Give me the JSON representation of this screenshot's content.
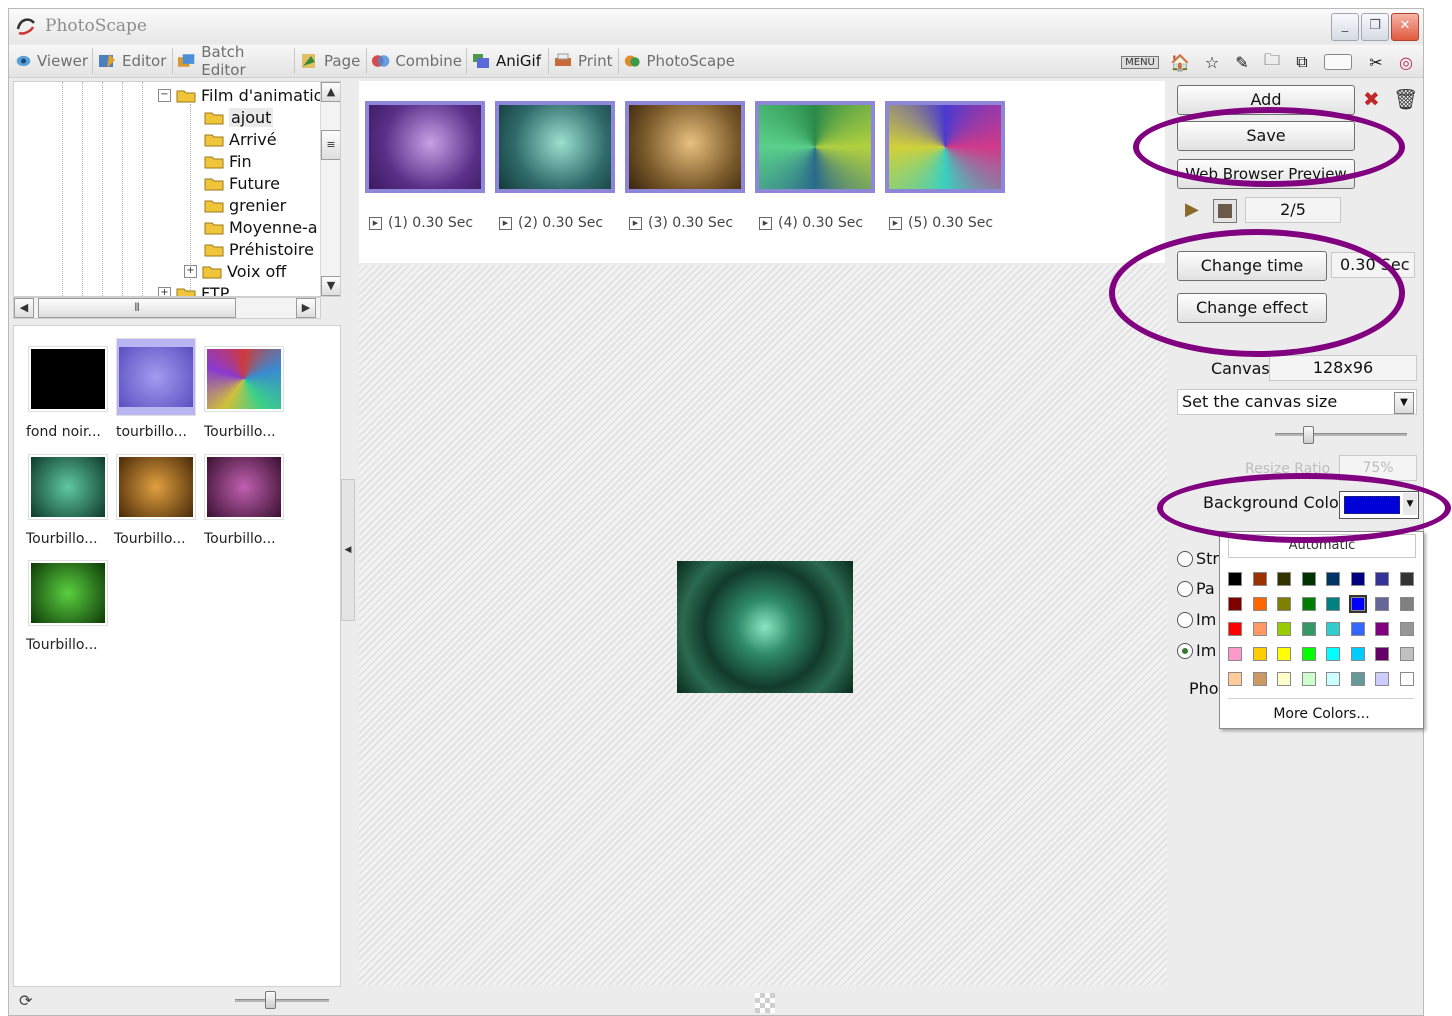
{
  "window": {
    "title": "PhotoScape",
    "minimize": "_",
    "restore": "❐",
    "close": "✕"
  },
  "colors": {
    "highlight_oval": "#800080",
    "selected_color": "#0000d8",
    "accent": "#8e86d8"
  },
  "tabs": [
    {
      "label": "Viewer",
      "icon": "viewer-icon"
    },
    {
      "label": "Editor",
      "icon": "editor-icon"
    },
    {
      "label": "Batch Editor",
      "icon": "batch-editor-icon"
    },
    {
      "label": "Page",
      "icon": "page-icon"
    },
    {
      "label": "Combine",
      "icon": "combine-icon"
    },
    {
      "label": "AniGif",
      "icon": "anigif-icon",
      "active": true
    },
    {
      "label": "Print",
      "icon": "print-icon"
    },
    {
      "label": "PhotoScape",
      "icon": "photoscape-icon"
    }
  ],
  "toolbar": {
    "menu_label": "MENU",
    "icons": [
      "home-icon",
      "star-icon",
      "tools-icon",
      "folder-open-icon",
      "copy-icon",
      "blank-icon",
      "scissors-icon",
      "help-icon"
    ]
  },
  "tree": {
    "root": "Film d'animatio",
    "items": [
      "ajout",
      "Arrivé",
      "Fin",
      "Future",
      "grenier",
      "Moyenne-a",
      "Préhistoire",
      "Voix off",
      "FTP"
    ],
    "selected": "ajout"
  },
  "thumbnails": [
    {
      "caption": "fond noir...",
      "swatch": "#000000"
    },
    {
      "caption": "tourbillo...",
      "swatch": "#7a6fcf",
      "selected": true
    },
    {
      "caption": "Tourbillo...",
      "swatch": "#3d2a44"
    },
    {
      "caption": "Tourbillo...",
      "swatch": "#1f5a4a"
    },
    {
      "caption": "Tourbillo...",
      "swatch": "#7a4f12"
    },
    {
      "caption": "Tourbillo...",
      "swatch": "#5a2a4e"
    },
    {
      "caption": "Tourbillo...",
      "swatch": "#1d4a12"
    }
  ],
  "frames": [
    {
      "caption": "(1) 0.30 Sec",
      "tint": "#6a3f8f"
    },
    {
      "caption": "(2) 0.30 Sec",
      "tint": "#2f6a6a"
    },
    {
      "caption": "(3) 0.30 Sec",
      "tint": "#7a5a2a"
    },
    {
      "caption": "(4) 0.30 Sec",
      "tint": "#2a6a3a"
    },
    {
      "caption": "(5) 0.30 Sec",
      "tint": "#4a3a8a"
    }
  ],
  "panel": {
    "add": "Add",
    "save": "Save",
    "web_preview": "Web Browser Preview",
    "frame_counter": "2/5",
    "change_time": "Change time",
    "time_value": "0.30 Sec",
    "change_effect": "Change effect",
    "canvas_label": "Canvas",
    "canvas_value": "128x96",
    "canvas_select": "Set the canvas size",
    "resize_label": "Resize Ratio",
    "resize_value": "75%",
    "background_label": "Background Color",
    "palette_auto": "Automatic",
    "more_colors": "More Colors...",
    "radio_labels": [
      "Str",
      "Pa",
      "Im",
      "Im"
    ],
    "photo_label": "Pho"
  },
  "palette_rows": [
    [
      "#000000",
      "#993300",
      "#333300",
      "#003300",
      "#003366",
      "#000080",
      "#333399",
      "#333333"
    ],
    [
      "#800000",
      "#ff6600",
      "#808000",
      "#008000",
      "#008080",
      "#0000ff",
      "#666699",
      "#808080"
    ],
    [
      "#ff0000",
      "#ff9966",
      "#99cc00",
      "#339966",
      "#33cccc",
      "#3366ff",
      "#800080",
      "#969696"
    ],
    [
      "#ff99cc",
      "#ffcc00",
      "#ffff00",
      "#00ff00",
      "#00ffff",
      "#00ccff",
      "#660066",
      "#c0c0c0"
    ],
    [
      "#ffcc99",
      "#cc9966",
      "#ffffcc",
      "#ccffcc",
      "#ccffff",
      "#669999",
      "#ccccff",
      "#ffffff"
    ]
  ]
}
